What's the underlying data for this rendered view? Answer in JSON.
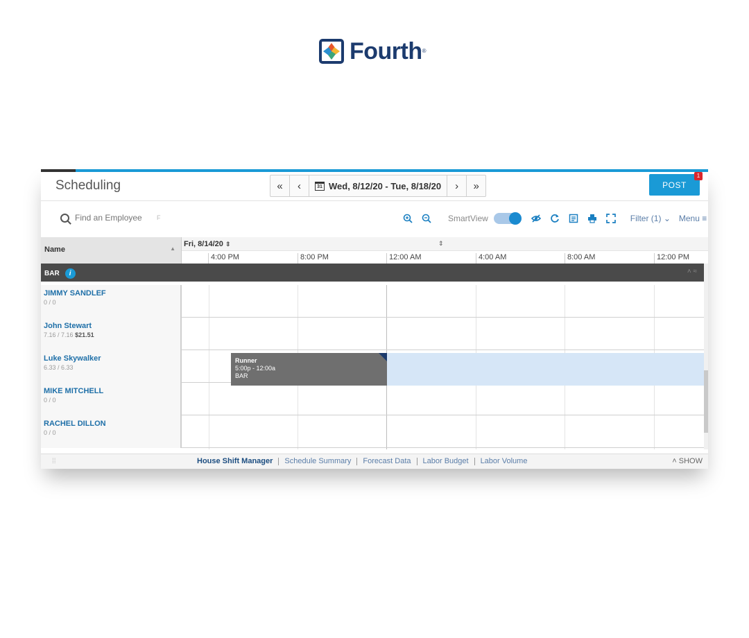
{
  "brand": {
    "name": "Fourth",
    "mark": "®"
  },
  "header": {
    "title": "Scheduling",
    "nav_first": "«",
    "nav_prev": "‹",
    "calendar_day": "31",
    "date_range": "Wed, 8/12/20 - Tue, 8/18/20",
    "nav_next": "›",
    "nav_last": "»",
    "post_label": "POST",
    "post_badge": "1"
  },
  "toolbar": {
    "search_placeholder": "Find an Employee",
    "search_hint": "F",
    "smartview_label": "SmartView",
    "smartview_on": true,
    "filter_label": "Filter (1)",
    "menu_label": "Menu"
  },
  "grid": {
    "name_header": "Name",
    "day_label": "Fri, 8/14/20",
    "hours": [
      "4:00 PM",
      "8:00 PM",
      "12:00 AM",
      "4:00 AM",
      "8:00 AM",
      "12:00 PM"
    ],
    "group": {
      "label": "BAR",
      "info": "i"
    },
    "employees": [
      {
        "name": "JIMMY SANDLEF",
        "hours": "0 / 0",
        "cost": ""
      },
      {
        "name": "John Stewart",
        "hours": "7.16 / 7.16",
        "cost": "$21.51"
      },
      {
        "name": "Luke Skywalker",
        "hours": "6.33 / 6.33",
        "cost": ""
      },
      {
        "name": "MIKE MITCHELL",
        "hours": "0 / 0",
        "cost": ""
      },
      {
        "name": "RACHEL DILLON",
        "hours": "0 / 0",
        "cost": ""
      }
    ],
    "shift": {
      "role": "Runner",
      "time": "5:00p - 12:00a",
      "dept": "BAR"
    }
  },
  "footer": {
    "tabs": [
      "House Shift Manager",
      "Schedule Summary",
      "Forecast Data",
      "Labor Budget",
      "Labor Volume"
    ],
    "show_label": "SHOW"
  },
  "colors": {
    "accent": "#1a9ad6",
    "brand_navy": "#1c3b6e",
    "shift": "#6f6f6f",
    "availability": "#d6e6f7"
  }
}
